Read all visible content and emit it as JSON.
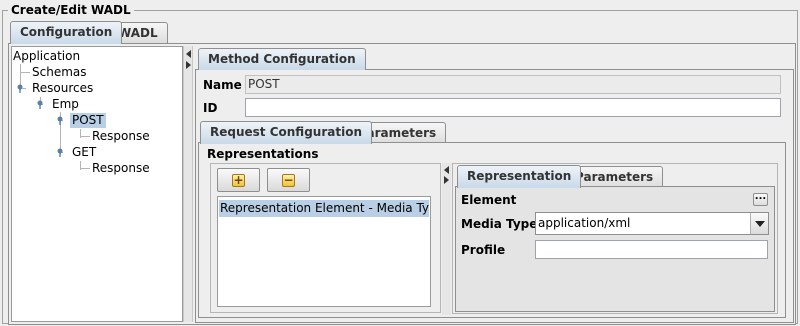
{
  "window": {
    "title": "Create/Edit WADL"
  },
  "top_tabs": [
    {
      "label": "Configuration",
      "selected": true
    },
    {
      "label": "WADL",
      "selected": false
    }
  ],
  "tree": {
    "nodes": [
      {
        "label": "Application",
        "depth": 0
      },
      {
        "label": "Schemas",
        "depth": 1
      },
      {
        "label": "Resources",
        "depth": 1
      },
      {
        "label": "Emp",
        "depth": 2
      },
      {
        "label": "POST",
        "depth": 3,
        "selected": true
      },
      {
        "label": "Response",
        "depth": 4
      },
      {
        "label": "GET",
        "depth": 3
      },
      {
        "label": "Response",
        "depth": 4
      }
    ]
  },
  "method_panel": {
    "tab_label": "Method Configuration",
    "name_label": "Name",
    "name_value": "POST",
    "id_label": "ID",
    "id_value": ""
  },
  "request_tabs": [
    {
      "label": "Request Configuration",
      "selected": true
    },
    {
      "label": "Parameters",
      "selected": false
    }
  ],
  "representations": {
    "title": "Representations",
    "add_icon": "plus-icon",
    "remove_icon": "minus-icon",
    "items": [
      "Representation Element - Media Typ..."
    ]
  },
  "representation_tabs": [
    {
      "label": "Representation",
      "selected": true
    },
    {
      "label": "Parameters",
      "selected": false
    }
  ],
  "representation_form": {
    "element_label": "Element",
    "element_button": "...",
    "media_type_label": "Media Type",
    "media_type_value": "application/xml",
    "profile_label": "Profile",
    "profile_value": ""
  },
  "colors": {
    "selection": "#b8cfe5",
    "selected_tab": "#c9d9e8",
    "background": "#eeeeee"
  }
}
